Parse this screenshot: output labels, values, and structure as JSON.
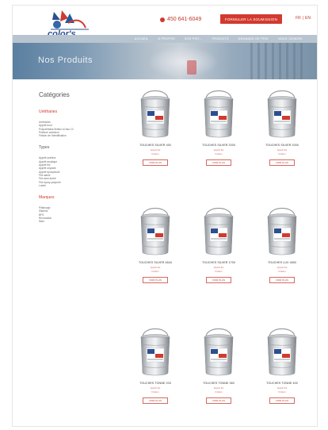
{
  "header": {
    "logo_text": "color's",
    "phone": "450 641-6049",
    "cta_label": "FORMULER LA SOUMISSION",
    "lang": [
      "FR",
      "|",
      "EN"
    ],
    "accent": "#d13a2e"
  },
  "nav": {
    "items": [
      "ACCUEIL",
      "À PROPOS",
      "NOS PRO...",
      "PRODUITS",
      "DEMANDE DE PRIX",
      "NOUS JOINDRE"
    ]
  },
  "banner": {
    "title": "Nos Produits"
  },
  "sidebar": {
    "title": "Catégories",
    "groups": [
      {
        "title": "Uréthanes",
        "items": [
          "Uréthanes",
          "Apprêt-bouf",
          "Polyuréthane finition à l'eau 10",
          "Peinture cadmium",
          "Finition de l'identification"
        ]
      },
      {
        "title": "Types",
        "items": [
          "Apprêt-scelleur",
          "Apprêt acrylique",
          "Apprêt fini",
          "Apprêt oxydant",
          "Apprêt époxyboule",
          "Fini satiné",
          "Fini semi-lustré",
          "Fini époxy-polyurée",
          "Lustré"
        ]
      },
      {
        "title": "Marques",
        "items": [
          "Pittsburgh",
          "Sikkens",
          "BFS",
          "Renovation",
          "Maxi"
        ]
      }
    ]
  },
  "products": [
    {
      "name": "TOUCHES SILVER 400",
      "sub1": "Apprêt fini",
      "sub2": "Finition",
      "button": "VOIR PLUS"
    },
    {
      "name": "TOUCHES SILVER 2000",
      "sub1": "Apprêt fini",
      "sub2": "Finition",
      "button": "VOIR PLUS"
    },
    {
      "name": "TOUCHES SILVER 2000",
      "sub1": "Apprêt fini",
      "sub2": "Finition",
      "button": "VOIR PLUS"
    },
    {
      "name": "TOUCHES SILVER 4844",
      "sub1": "Apprêt fini",
      "sub2": "Finition",
      "button": "VOIR PLUS"
    },
    {
      "name": "TOUCHES SILVER 1700",
      "sub1": "Apprêt fini",
      "sub2": "Finition",
      "button": "VOIR PLUS"
    },
    {
      "name": "TOUCHES LUX 4600",
      "sub1": "Apprêt fini",
      "sub2": "Finition",
      "button": "VOIR PLUS"
    },
    {
      "name": "TOUCHES TONNE 200",
      "sub1": "Apprêt fini",
      "sub2": "Finition",
      "button": "VOIR PLUS"
    },
    {
      "name": "TOUCHES TONNE 360",
      "sub1": "Apprêt fini",
      "sub2": "Finition",
      "button": "VOIR PLUS"
    },
    {
      "name": "TOUCHES TONNE 400",
      "sub1": "Apprêt fini",
      "sub2": "Finition",
      "button": "VOIR PLUS"
    }
  ]
}
